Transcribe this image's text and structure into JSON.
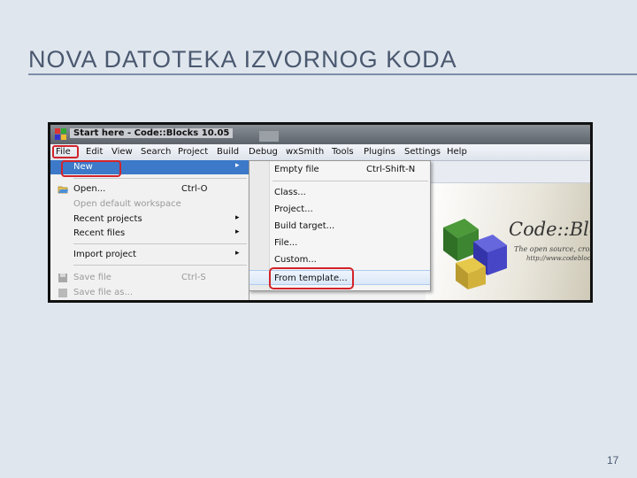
{
  "slide": {
    "title": "NOVA DATOTEKA IZVORNOG KODA",
    "page_number": "17"
  },
  "window": {
    "title": "Start here - Code::Blocks 10.05"
  },
  "menubar": {
    "items": [
      "File",
      "Edit",
      "View",
      "Search",
      "Project",
      "Build",
      "Debug",
      "wxSmith",
      "Tools",
      "Plugins",
      "Settings",
      "Help"
    ]
  },
  "file_menu": {
    "new": "New",
    "open": "Open...",
    "open_shortcut": "Ctrl-O",
    "open_default_workspace": "Open default workspace",
    "recent_projects": "Recent projects",
    "recent_files": "Recent files",
    "import_project": "Import project",
    "save_file": "Save file",
    "save_shortcut": "Ctrl-S",
    "save_file_as": "Save file as..."
  },
  "new_submenu": {
    "empty_file": "Empty file",
    "empty_file_shortcut": "Ctrl-Shift-N",
    "class": "Class...",
    "project": "Project...",
    "build_target": "Build target...",
    "file": "File...",
    "custom": "Custom...",
    "from_template": "From template..."
  },
  "splash": {
    "brand": "Code::Blocks",
    "tagline": "The open source, cross-platform",
    "url": "http://www.codeblocks.org"
  },
  "colors": {
    "highlight_red": "#d2232a",
    "menu_active_blue": "#3c79c8",
    "title_color": "#4a5870"
  },
  "icons": {
    "arrow": "▸"
  }
}
